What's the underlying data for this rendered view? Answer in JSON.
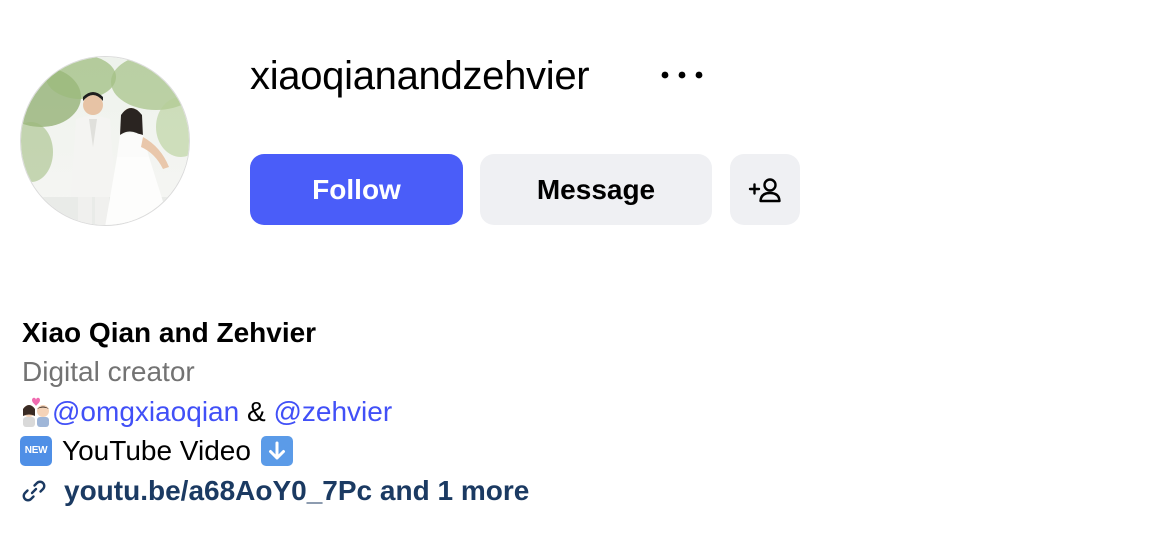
{
  "profile": {
    "username": "xiaoqianandzehvier",
    "full_name": "Xiao Qian and Zehvier",
    "category": "Digital creator"
  },
  "actions": {
    "follow_label": "Follow",
    "message_label": "Message",
    "more_icon": "more-horizontal-icon",
    "suggest_icon": "add-person-icon"
  },
  "bio": {
    "line1": {
      "emoji": "couple-with-heart-emoji",
      "mention1": "@omgxiaoqian",
      "separator": "&",
      "mention2": "@zehvier"
    },
    "line2": {
      "badge": "NEW",
      "text": "YouTube Video",
      "arrow_icon": "down-arrow-button-icon"
    }
  },
  "link": {
    "icon": "link-icon",
    "text": "youtu.be/a68AoY0_7Pc and 1 more"
  },
  "colors": {
    "primary": "#4a5df9",
    "secondary_button": "#eff0f3",
    "mention": "#4150f7",
    "link": "#1b3a62",
    "muted": "#737373"
  }
}
